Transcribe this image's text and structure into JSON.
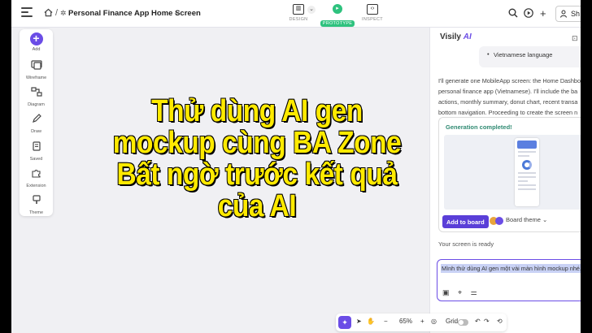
{
  "topbar": {
    "title": "Personal Finance App Home Screen",
    "modes": [
      {
        "label": "DESIGN",
        "icon": "design-icon"
      },
      {
        "label": "PROTOTYPE",
        "icon": "prototype-icon"
      },
      {
        "label": "INSPECT",
        "icon": "code-icon"
      }
    ],
    "share_label": "Sh"
  },
  "sidebar": {
    "items": [
      {
        "label": "Add",
        "icon": "plus-icon"
      },
      {
        "label": "Wireframe",
        "icon": "wireframe-icon"
      },
      {
        "label": "Diagram",
        "icon": "diagram-icon"
      },
      {
        "label": "Draw",
        "icon": "pen-icon"
      },
      {
        "label": "Saved",
        "icon": "bookmark-icon"
      },
      {
        "label": "Extension",
        "icon": "puzzle-icon"
      },
      {
        "label": "Theme",
        "icon": "palette-icon"
      }
    ]
  },
  "assistant": {
    "brand_prefix": "Visily",
    "brand_suffix": "AI",
    "language_item": "Vietnamese language",
    "message_lines": [
      "I'll generate one MobileApp screen: the Home Dashbo",
      "personal finance app (Vietnamese). I'll include the ba",
      "actions, monthly summary, donut chart, recent transa",
      "bottom navigation. Proceeding to create the screen n"
    ],
    "generation_title": "Generation completed!",
    "add_to_board": "Add to board",
    "board_theme": "Board theme",
    "ready_text": "Your screen is ready",
    "input_text": "Mình thử dùng AI gen một vài màn hình mockup nhé."
  },
  "bottombar": {
    "zoom": "65%",
    "grid_label": "Grid"
  },
  "overlay": {
    "lines": [
      "Thử dùng AI gen",
      "mockup cùng BA Zone",
      "Bất ngờ trước kết quả",
      "của AI"
    ]
  },
  "colors": {
    "accent": "#6b4de6",
    "prototype_green": "#2ec27e",
    "caption_yellow": "#ffea00"
  }
}
